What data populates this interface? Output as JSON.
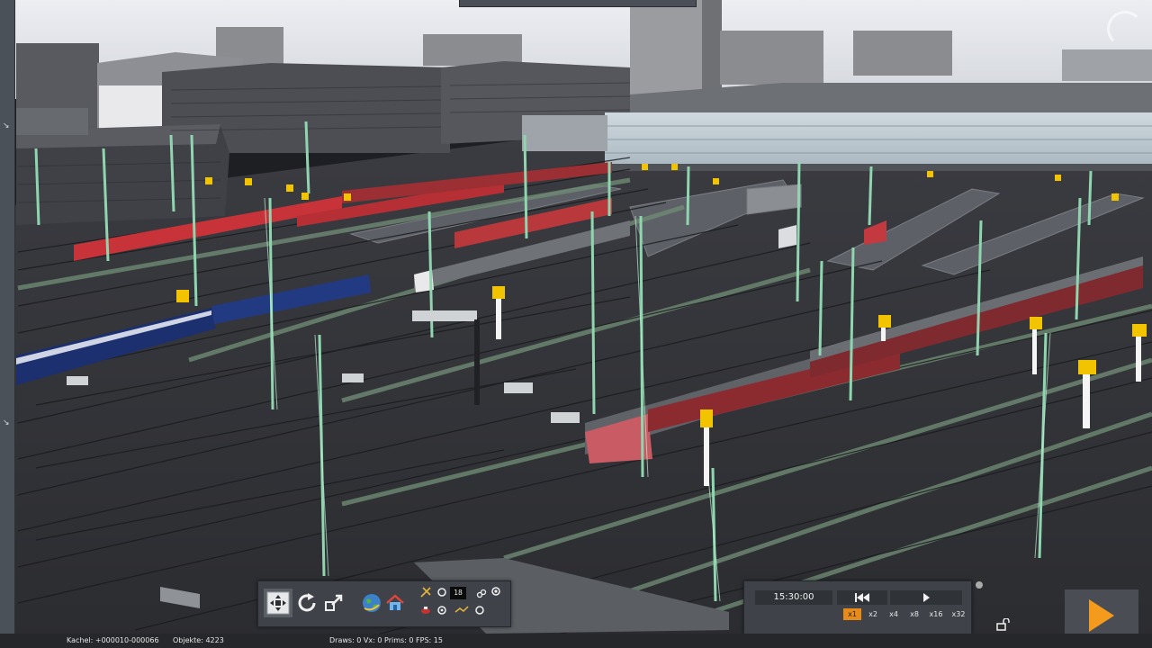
{
  "status": {
    "tile": "Kachel: +000010-000066",
    "objects": "Objekte: 4223",
    "stats": "Draws: 0 Vx: 0 Prims: 0 FPS: 15"
  },
  "toolbar": {
    "counter": "18",
    "buttons": [
      {
        "icon": "move-arrows-icon"
      },
      {
        "icon": "rotate-icon"
      },
      {
        "icon": "select-mode-icon"
      },
      {
        "icon": "globe-icon"
      },
      {
        "icon": "home-icon"
      },
      {
        "icon": "signal-editor-icon"
      },
      {
        "icon": "track-object-icon"
      }
    ]
  },
  "time_panel": {
    "clock": "15:30:00",
    "rewind_icon": "rewind-icon",
    "play_icon": "play-small-icon",
    "speeds": [
      "x1",
      "x2",
      "x4",
      "x8",
      "x16",
      "x32"
    ],
    "active_speed": "x1"
  },
  "colors": {
    "panel": "#3f4349",
    "accent": "#e88a17",
    "catenary": "#8fd6b0"
  }
}
